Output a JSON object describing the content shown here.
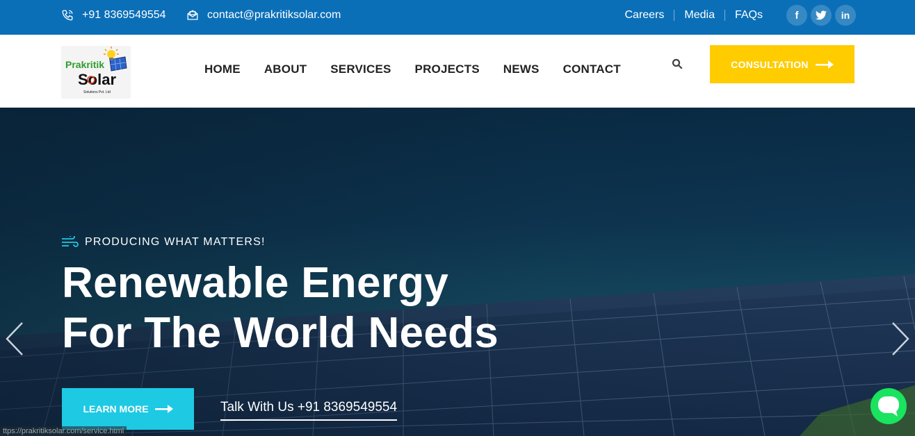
{
  "topbar": {
    "phone": "+91 8369549554",
    "email": "contact@prakritiksolar.com",
    "links": [
      "Careers",
      "Media",
      "FAQs"
    ],
    "social": [
      "facebook-icon",
      "twitter-icon",
      "linkedin-icon"
    ]
  },
  "logo": {
    "line1": "Prakritik",
    "line2": "Solar",
    "line3": "Solutions Pvt. Ltd"
  },
  "nav": {
    "items": [
      "HOME",
      "ABOUT",
      "SERVICES",
      "PROJECTS",
      "NEWS",
      "CONTACT"
    ]
  },
  "cta": {
    "label": "CONSULTATION"
  },
  "hero": {
    "tagline": "PRODUCING WHAT MATTERS!",
    "headline_line1": "Renewable Energy",
    "headline_line2": "For The World Needs",
    "learn_more": "LEARN MORE",
    "talk": "Talk With Us +91 8369549554"
  },
  "status_url": "ttps://prakritiksolar.com/service.html",
  "colors": {
    "topbar": "#0b6fb8",
    "cta": "#ffcc00",
    "learn": "#1ec9e3",
    "chat": "#19e35f"
  }
}
